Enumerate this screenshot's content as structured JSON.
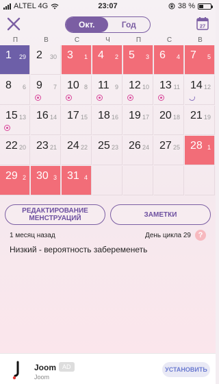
{
  "status_bar": {
    "carrier": "ALTEL 4G",
    "time": "23:07",
    "battery": "38 %",
    "battery_level": 0.38
  },
  "header": {
    "tabs": [
      {
        "label": "Окт.",
        "active": true
      },
      {
        "label": "Год",
        "active": false
      }
    ],
    "calendar_icon_day": "27"
  },
  "weekdays": [
    "П",
    "В",
    "С",
    "Ч",
    "П",
    "С",
    "В"
  ],
  "calendar": {
    "rows": [
      [
        {
          "day": "1",
          "cycle": "29",
          "type": "today"
        },
        {
          "day": "2",
          "cycle": "30",
          "type": "normal"
        },
        {
          "day": "3",
          "cycle": "1",
          "type": "period"
        },
        {
          "day": "4",
          "cycle": "2",
          "type": "period"
        },
        {
          "day": "5",
          "cycle": "3",
          "type": "period"
        },
        {
          "day": "6",
          "cycle": "4",
          "type": "period"
        },
        {
          "day": "7",
          "cycle": "5",
          "type": "period"
        }
      ],
      [
        {
          "day": "8",
          "cycle": "6",
          "type": "normal"
        },
        {
          "day": "9",
          "cycle": "7",
          "type": "normal",
          "marker": "ovulation"
        },
        {
          "day": "10",
          "cycle": "8",
          "type": "normal",
          "marker": "ovulation"
        },
        {
          "day": "11",
          "cycle": "9",
          "type": "normal",
          "marker": "ovulation"
        },
        {
          "day": "12",
          "cycle": "10",
          "type": "normal",
          "marker": "ovulation"
        },
        {
          "day": "13",
          "cycle": "11",
          "type": "normal",
          "marker": "ovulation"
        },
        {
          "day": "14",
          "cycle": "12",
          "type": "normal",
          "marker": "moon"
        }
      ],
      [
        {
          "day": "15",
          "cycle": "13",
          "type": "normal",
          "marker": "ovulation"
        },
        {
          "day": "16",
          "cycle": "14",
          "type": "normal"
        },
        {
          "day": "17",
          "cycle": "15",
          "type": "normal"
        },
        {
          "day": "18",
          "cycle": "16",
          "type": "normal"
        },
        {
          "day": "19",
          "cycle": "17",
          "type": "normal"
        },
        {
          "day": "20",
          "cycle": "18",
          "type": "normal"
        },
        {
          "day": "21",
          "cycle": "19",
          "type": "normal"
        }
      ],
      [
        {
          "day": "22",
          "cycle": "20",
          "type": "normal"
        },
        {
          "day": "23",
          "cycle": "21",
          "type": "normal"
        },
        {
          "day": "24",
          "cycle": "22",
          "type": "normal"
        },
        {
          "day": "25",
          "cycle": "23",
          "type": "normal"
        },
        {
          "day": "26",
          "cycle": "24",
          "type": "normal"
        },
        {
          "day": "27",
          "cycle": "25",
          "type": "normal"
        },
        {
          "day": "28",
          "cycle": "1",
          "type": "period"
        }
      ],
      [
        {
          "day": "29",
          "cycle": "2",
          "type": "period"
        },
        {
          "day": "30",
          "cycle": "3",
          "type": "period"
        },
        {
          "day": "31",
          "cycle": "4",
          "type": "period"
        },
        {
          "day": "",
          "cycle": "",
          "type": "empty"
        },
        {
          "day": "",
          "cycle": "",
          "type": "empty"
        },
        {
          "day": "",
          "cycle": "",
          "type": "empty"
        },
        {
          "day": "",
          "cycle": "",
          "type": "empty"
        }
      ]
    ]
  },
  "actions": {
    "edit_label_line1": "РЕДАКТИРОВАНИЕ",
    "edit_label_line2": "МЕНСТРУАЦИЙ",
    "notes_label": "ЗАМЕТКИ"
  },
  "info": {
    "ago": "1 месяц назад",
    "cycle_day": "День цикла 29",
    "help": "?",
    "probability": "Низкий - вероятность забеременеть"
  },
  "ad": {
    "name": "Joom",
    "tag": "AD",
    "subtitle": "Joom",
    "install_label": "УСТАНОВИТЬ"
  },
  "colors": {
    "accent": "#7b5ea3",
    "period": "#f26d78",
    "today": "#6d5fa8",
    "ovulation": "#d9469a"
  }
}
